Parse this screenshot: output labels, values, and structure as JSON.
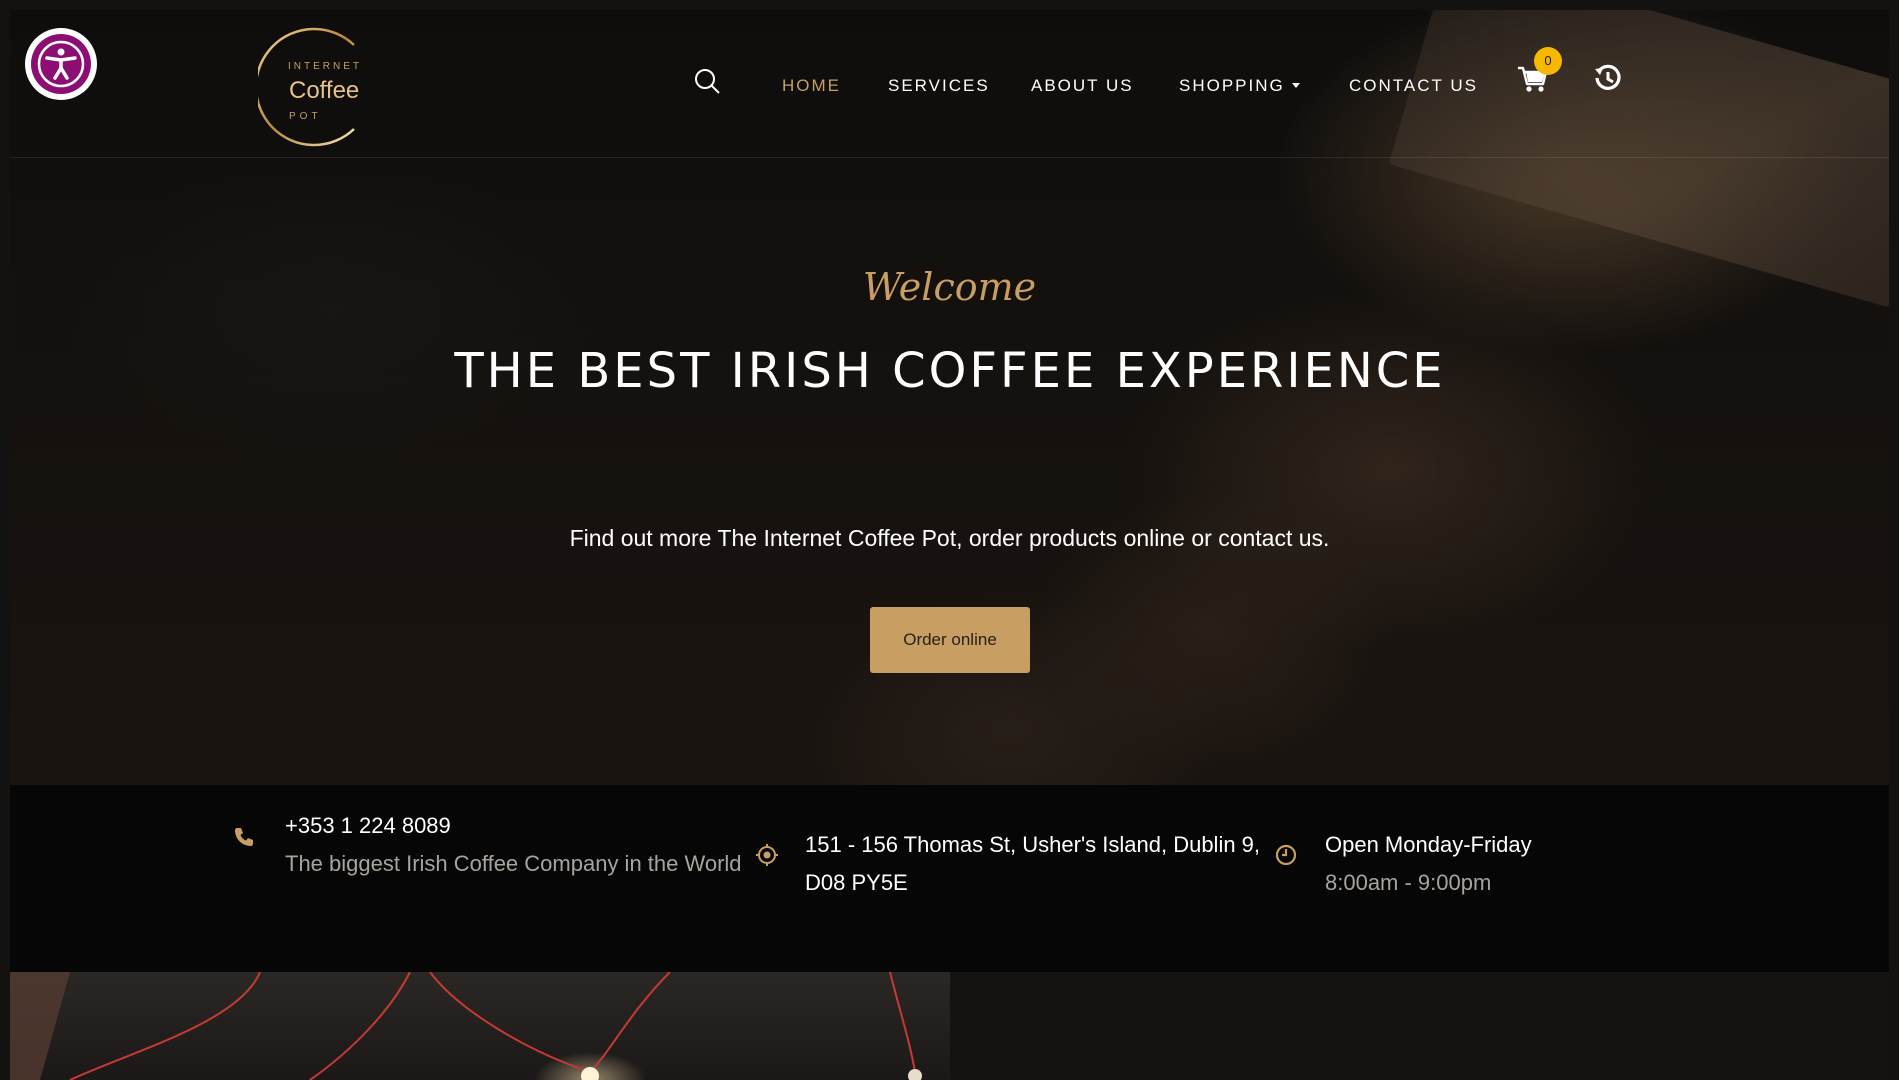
{
  "accessibility": {
    "icon": "accessibility-icon"
  },
  "brand": {
    "line1": "INTERNET",
    "line2": "Coffee",
    "line3": "POT"
  },
  "nav": {
    "search_icon": "search-icon",
    "items": [
      {
        "label": "HOME",
        "active": true
      },
      {
        "label": "SERVICES",
        "active": false
      },
      {
        "label": "ABOUT US",
        "active": false
      },
      {
        "label": "SHOPPING",
        "active": false,
        "dropdown": true
      },
      {
        "label": "CONTACT US",
        "active": false
      }
    ],
    "cart": {
      "icon": "shopping-cart-icon",
      "count": "0"
    },
    "history_icon": "history-icon"
  },
  "hero": {
    "welcome": "Welcome",
    "headline": "THE BEST IRISH COFFEE EXPERIENCE",
    "subtext": "Find out more The Internet Coffee Pot, order products online or contact us.",
    "cta": "Order online"
  },
  "info": {
    "phone": {
      "icon": "phone-icon",
      "title": "+353 1 224 8089",
      "subtitle": "The biggest Irish Coffee Company in the World"
    },
    "address": {
      "icon": "location-icon",
      "title": "151 - 156 Thomas St, Usher's Island, Dublin 9, D08 PY5E"
    },
    "hours": {
      "icon": "clock-icon",
      "title": "Open Monday-Friday",
      "subtitle": "8:00am - 9:00pm"
    }
  },
  "colors": {
    "accent": "#c99e63",
    "badge": "#f5b700",
    "accessibility": "#8d0e73",
    "background": "#0b0a09"
  }
}
